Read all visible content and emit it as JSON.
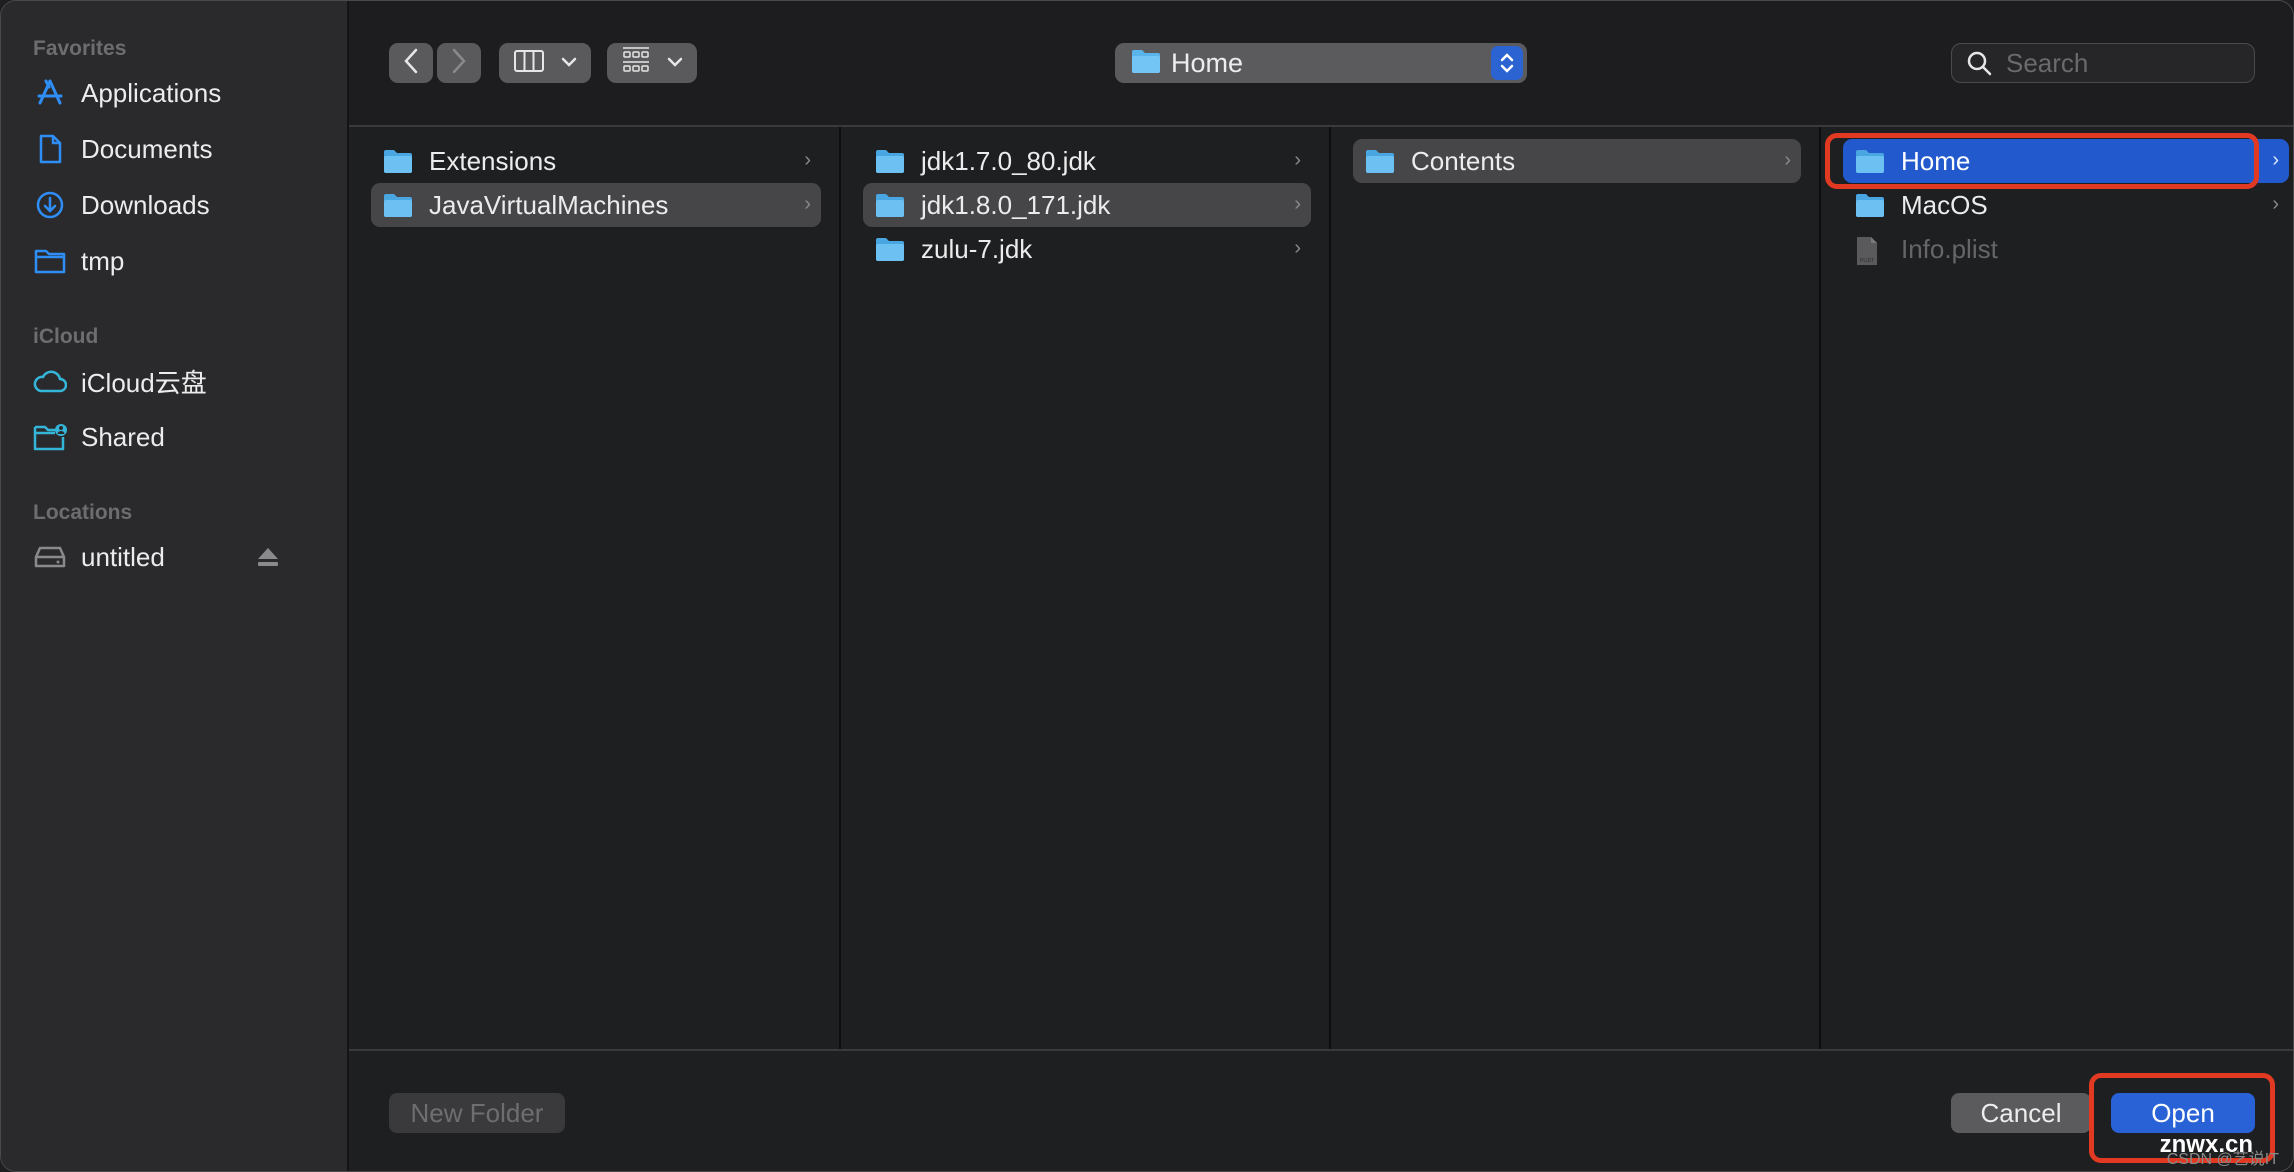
{
  "sidebar": {
    "sections": [
      {
        "title": "Favorites",
        "items": [
          {
            "label": "Applications",
            "icon": "applications-icon"
          },
          {
            "label": "Documents",
            "icon": "document-icon"
          },
          {
            "label": "Downloads",
            "icon": "download-icon"
          },
          {
            "label": "tmp",
            "icon": "folder-icon"
          }
        ]
      },
      {
        "title": "iCloud",
        "items": [
          {
            "label": "iCloud云盘",
            "icon": "cloud-icon"
          },
          {
            "label": "Shared",
            "icon": "shared-folder-icon"
          }
        ]
      },
      {
        "title": "Locations",
        "items": [
          {
            "label": "untitled",
            "icon": "drive-icon",
            "eject": "eject-icon"
          }
        ]
      }
    ]
  },
  "toolbar": {
    "back": "chevron-left-icon",
    "forward": "chevron-right-icon",
    "view_mode": "column-view-icon",
    "group_mode": "grid-icon",
    "path_label": "Home",
    "search_placeholder": "Search",
    "search_value": ""
  },
  "columns": [
    {
      "items": [
        {
          "label": "Extensions",
          "type": "folder",
          "state": "none"
        },
        {
          "label": "JavaVirtualMachines",
          "type": "folder",
          "state": "selected-inactive"
        }
      ]
    },
    {
      "items": [
        {
          "label": "jdk1.7.0_80.jdk",
          "type": "folder",
          "state": "none"
        },
        {
          "label": "jdk1.8.0_171.jdk",
          "type": "folder",
          "state": "selected-inactive"
        },
        {
          "label": "zulu-7.jdk",
          "type": "folder",
          "state": "none"
        }
      ]
    },
    {
      "items": [
        {
          "label": "Contents",
          "type": "folder",
          "state": "selected-inactive"
        }
      ]
    },
    {
      "items": [
        {
          "label": "Home",
          "type": "folder",
          "state": "selected-active"
        },
        {
          "label": "MacOS",
          "type": "folder",
          "state": "none"
        },
        {
          "label": "Info.plist",
          "type": "file",
          "state": "disabled",
          "file_badge": "PLIST"
        }
      ]
    }
  ],
  "bottom": {
    "new_folder": "New Folder",
    "cancel": "Cancel",
    "open": "Open"
  },
  "watermark": {
    "main": "znwx.cn",
    "sub": "CSDN @艺说IT"
  },
  "colors": {
    "accent": "#2259cc",
    "annotation": "#e23a22",
    "sidebar_icon": "#2f8ef5"
  }
}
